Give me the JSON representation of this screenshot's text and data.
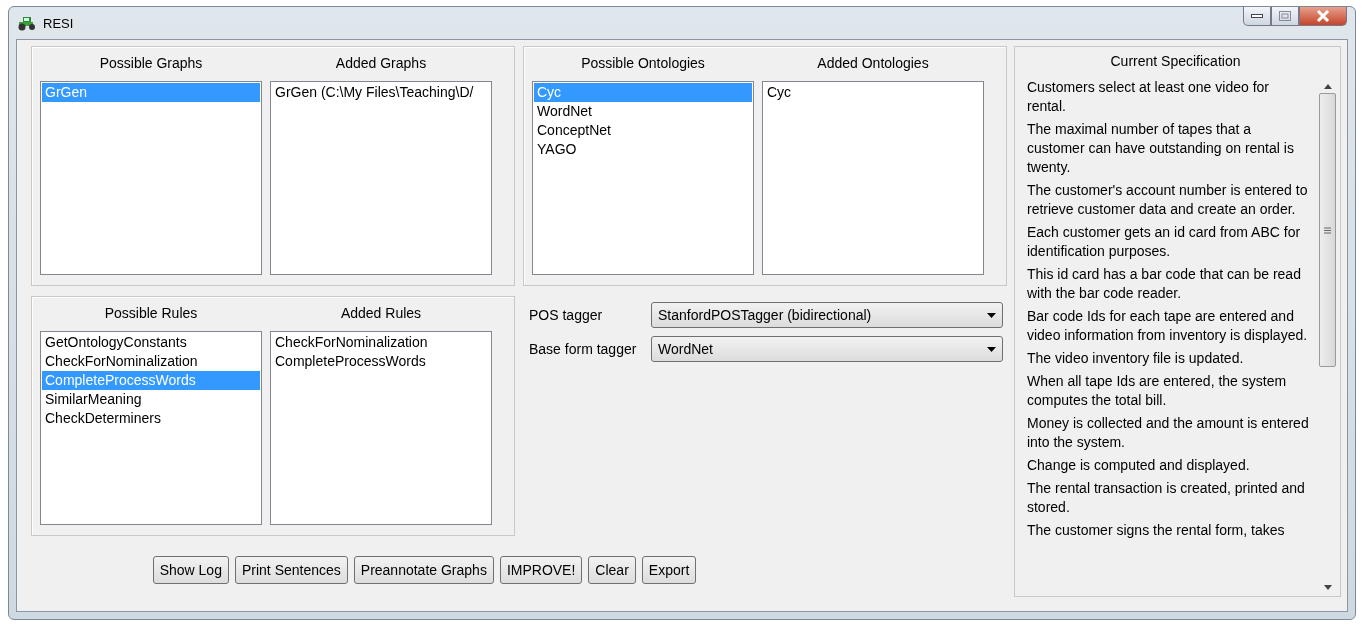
{
  "window": {
    "title": "RESI"
  },
  "graphs": {
    "possible_title": "Possible Graphs",
    "added_title": "Added Graphs",
    "possible": [
      {
        "label": "GrGen",
        "selected": true
      }
    ],
    "added": [
      {
        "label": "GrGen (C:\\My Files\\Teaching\\D/",
        "selected": false
      }
    ]
  },
  "ontologies": {
    "possible_title": "Possible Ontologies",
    "added_title": "Added Ontologies",
    "possible": [
      {
        "label": "Cyc",
        "selected": true
      },
      {
        "label": "WordNet",
        "selected": false
      },
      {
        "label": "ConceptNet",
        "selected": false
      },
      {
        "label": "YAGO",
        "selected": false
      }
    ],
    "added": [
      {
        "label": "Cyc",
        "selected": false
      }
    ]
  },
  "rules": {
    "possible_title": "Possible Rules",
    "added_title": "Added Rules",
    "possible": [
      {
        "label": "GetOntologyConstants",
        "selected": false
      },
      {
        "label": "CheckForNominalization",
        "selected": false
      },
      {
        "label": "CompleteProcessWords",
        "selected": true
      },
      {
        "label": "SimilarMeaning",
        "selected": false
      },
      {
        "label": "CheckDeterminers",
        "selected": false
      }
    ],
    "added": [
      {
        "label": "CheckForNominalization",
        "selected": false
      },
      {
        "label": "CompleteProcessWords",
        "selected": false
      }
    ]
  },
  "taggers": [
    {
      "label": "POS tagger",
      "value": "StanfordPOSTagger (bidirectional)"
    },
    {
      "label": "Base form tagger",
      "value": "WordNet"
    }
  ],
  "buttons": [
    "Show Log",
    "Print Sentences",
    "Preannotate Graphs",
    "IMPROVE!",
    "Clear",
    "Export"
  ],
  "specification": {
    "title": "Current Specification",
    "sentences": [
      "Customers select at least one video for rental.",
      "The maximal number of tapes that a customer can have outstanding on rental is twenty.",
      "The customer's account number is entered to retrieve customer data and create an order.",
      "Each customer gets an id card from ABC for identification purposes.",
      "This id card has a bar code that can be read with the bar code reader.",
      "Bar code Ids for each tape are entered and video information from inventory is displayed.",
      "The video inventory file is updated.",
      "When all tape Ids are entered, the system computes the total bill.",
      "Money is collected and the amount is entered into the system.",
      "Change is computed and displayed.",
      "The rental transaction is created, printed and stored.",
      "The customer signs the rental form, takes"
    ]
  }
}
